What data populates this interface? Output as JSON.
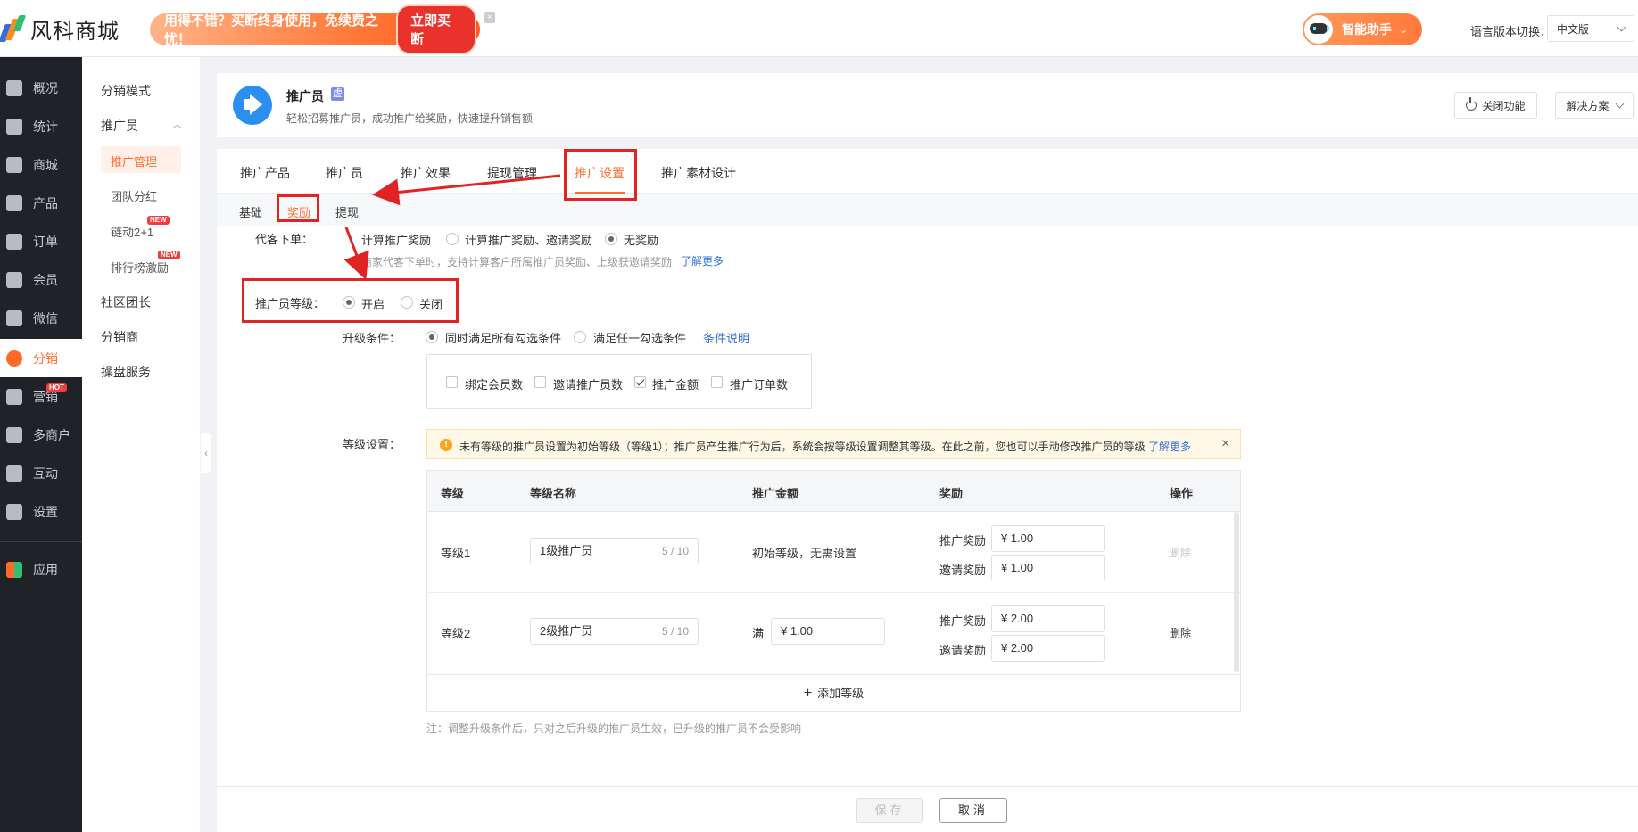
{
  "topbar": {
    "logo_text": "风科商城",
    "promo_text": "用得不错？买断终身使用，免续费之忧！",
    "promo_button": "立即买断",
    "promo_close": "×",
    "assistant_label": "智能助手",
    "lang_label": "语言版本切换：",
    "lang_value": "中文版"
  },
  "leftnav": {
    "items": [
      {
        "label": "概况",
        "icon": "layers-icon"
      },
      {
        "label": "统计",
        "icon": "chart-icon"
      },
      {
        "label": "商城",
        "icon": "shop-icon"
      },
      {
        "label": "产品",
        "icon": "grid-icon"
      },
      {
        "label": "订单",
        "icon": "order-icon"
      },
      {
        "label": "会员",
        "icon": "crown-icon"
      },
      {
        "label": "微信",
        "icon": "wechat-icon"
      },
      {
        "label": "分销",
        "icon": "user-icon"
      },
      {
        "label": "营销",
        "icon": "flag-icon",
        "badge": "HOT"
      },
      {
        "label": "多商户",
        "icon": "store-icon"
      },
      {
        "label": "互动",
        "icon": "apps-icon"
      },
      {
        "label": "设置",
        "icon": "gear-icon"
      },
      {
        "label": "应用",
        "icon": "app-icon"
      }
    ]
  },
  "subnav": {
    "items": [
      "分销模式",
      "推广员",
      "推广管理",
      "团队分红",
      "链动2+1",
      "排行榜激励",
      "社区团长",
      "分销商",
      "操盘服务"
    ],
    "badge_new": "NEW"
  },
  "header": {
    "title": "推广员",
    "tag": "虚",
    "desc": "轻松招募推广员，成功推广给奖励，快速提升销售额",
    "close_btn": "关闭功能",
    "solution_btn": "解决方案"
  },
  "tabs": [
    "推广产品",
    "推广员",
    "推广效果",
    "提现管理",
    "推广设置",
    "推广素材设计"
  ],
  "subtabs": [
    "基础",
    "奖励",
    "提现"
  ],
  "form": {
    "proxy_order_label": "代客下单：",
    "proxy_options": [
      "计算推广奖励",
      "计算推广奖励、邀请奖励",
      "无奖励"
    ],
    "proxy_hint": "商家代客下单时，支持计算客户所属推广员奖励、上级获邀请奖励",
    "learn_more": "了解更多",
    "level_label": "推广员等级：",
    "level_options": [
      "开启",
      "关闭"
    ],
    "upgrade_label": "升级条件：",
    "upgrade_options": [
      "同时满足所有勾选条件",
      "满足任一勾选条件"
    ],
    "condition_link": "条件说明",
    "conditions": [
      {
        "label": "绑定会员数",
        "checked": false
      },
      {
        "label": "邀请推广员数",
        "checked": false
      },
      {
        "label": "推广金额",
        "checked": true
      },
      {
        "label": "推广订单数",
        "checked": false
      }
    ],
    "level_setting_label": "等级设置：",
    "alert_text": "未有等级的推广员设置为初始等级（等级1）；推广员产生推广行为后，系统会按等级设置调整其等级。在此之前，您也可以手动修改推广员的等级",
    "alert_link": "了解更多",
    "table": {
      "headers": [
        "等级",
        "等级名称",
        "推广金额",
        "奖励",
        "操作"
      ],
      "rows": [
        {
          "level": "等级1",
          "name": "1级推广员",
          "count": "5 / 10",
          "amount_text": "初始等级，无需设置",
          "reward_label": "推广奖励",
          "reward": "¥  1.00",
          "invite_label": "邀请奖励",
          "invite": "¥  1.00",
          "action": "删除"
        },
        {
          "level": "等级2",
          "name": "2级推广员",
          "count": "5 / 10",
          "amount_prefix": "满",
          "amount": "¥  1.00",
          "reward_label": "推广奖励",
          "reward": "¥  2.00",
          "invite_label": "邀请奖励",
          "invite": "¥  2.00",
          "action": "删除"
        }
      ],
      "add_label": "添加等级"
    },
    "note": "注：调整升级条件后，只对之后升级的推广员生效，已升级的推广员不会受影响"
  },
  "footer": {
    "save": "保存",
    "cancel": "取消"
  }
}
